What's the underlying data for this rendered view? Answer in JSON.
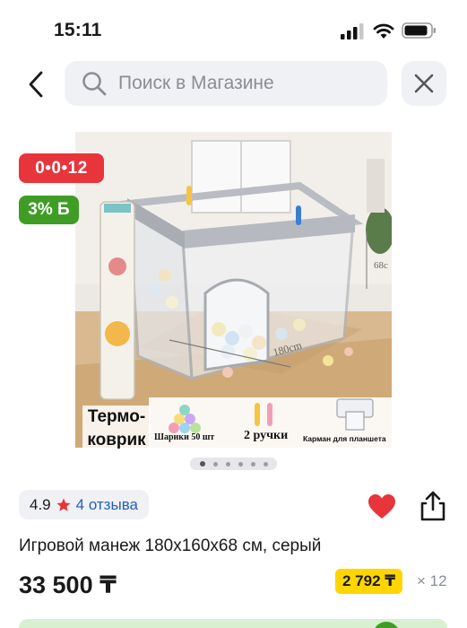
{
  "status_bar": {
    "time": "15:11"
  },
  "search": {
    "placeholder": "Поиск в Магазине"
  },
  "badges": {
    "timer": "0•0•12",
    "bonus": "3% Б"
  },
  "image_overlay": {
    "thermo_label": "Термо-коврик",
    "balls_label": "Шарики 50 шт",
    "handles_label": "2 ручки",
    "pocket_label": "Карман для планшета",
    "dimension_width": "180cm",
    "dimension_height": "68c"
  },
  "gallery": {
    "total": 6,
    "active_index": 0
  },
  "rating": {
    "value": "4.9",
    "reviews": "4 отзыва"
  },
  "product": {
    "title": "Игровой манеж 180х160х68 см, серый",
    "price": "33 500 ₸",
    "installment_price": "2 792 ₸",
    "installment_count": "× 12"
  },
  "colors": {
    "accent_red": "#e8343b",
    "accent_green": "#3f9d25",
    "installment_yellow": "#ffd500",
    "link_blue": "#1f5fbf"
  }
}
